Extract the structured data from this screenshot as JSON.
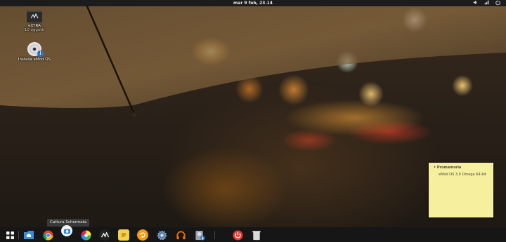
{
  "topbar": {
    "clock": "mar  9 feb, 23.14",
    "icons": [
      "volume-icon",
      "network-icon",
      "power-icon"
    ]
  },
  "desktop": {
    "icons": [
      {
        "label": "eXTRA",
        "sublabel": "10 oggetti",
        "icon": "folder-icon"
      },
      {
        "label": "Installa eMod OS",
        "icon": "install-disc-icon"
      }
    ]
  },
  "sticky_note": {
    "title": "• Promemoria",
    "body": "eMod OS 3.0 Omega 64-bit",
    "color": "#f6ef9e"
  },
  "tooltip": {
    "text": "Cattura Schermata"
  },
  "dock": {
    "items": [
      {
        "name": "app-grid-icon"
      },
      {
        "name": "file-manager-icon"
      },
      {
        "name": "chrome-icon"
      },
      {
        "name": "screenshot-icon"
      },
      {
        "name": "color-picker-icon"
      },
      {
        "name": "emod-icon"
      },
      {
        "name": "notes-icon"
      },
      {
        "name": "software-update-icon"
      },
      {
        "name": "settings-icon"
      },
      {
        "name": "headphones-icon"
      },
      {
        "name": "installer-icon"
      },
      {
        "name": "power-icon"
      },
      {
        "name": "trash-icon"
      }
    ]
  }
}
